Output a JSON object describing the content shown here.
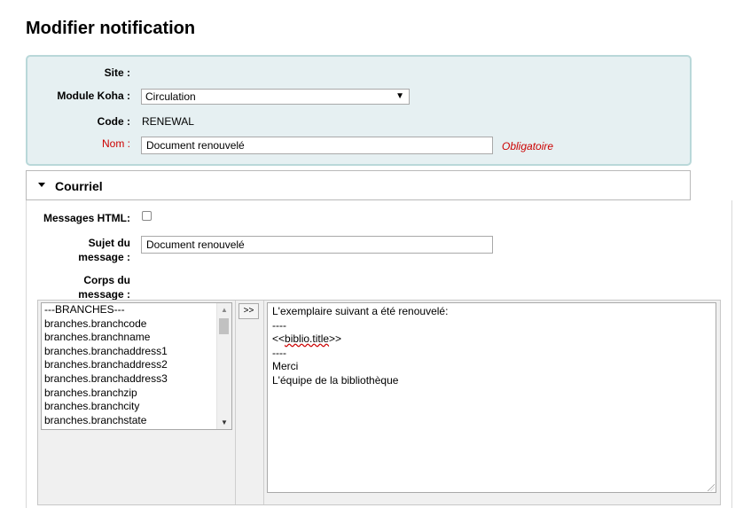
{
  "page": {
    "title": "Modifier notification"
  },
  "form": {
    "site_label": "Site :",
    "module_label": "Module Koha :",
    "module_value": "Circulation",
    "code_label": "Code :",
    "code_value": "RENEWAL",
    "name_label": "Nom :",
    "name_value": "Document renouvelé",
    "required_text": "Obligatoire"
  },
  "email_section": {
    "title": "Courriel",
    "html_label": "Messages HTML:",
    "html_checked": false,
    "subject_label_1": "Sujet du",
    "subject_label_2": "message :",
    "subject_value": "Document renouvelé",
    "body_label_1": "Corps du",
    "body_label_2": "message :",
    "insert_button": ">>",
    "fields": [
      "---BRANCHES---",
      "branches.branchcode",
      "branches.branchname",
      "branches.branchaddress1",
      "branches.branchaddress2",
      "branches.branchaddress3",
      "branches.branchzip",
      "branches.branchcity",
      "branches.branchstate"
    ],
    "body_lines": {
      "l1": "L'exemplaire suivant a été renouvelé:",
      "l2": "----",
      "l3_pre": "<<",
      "l3_word": "biblio.title",
      "l3_post": ">>",
      "l4": "----",
      "l5": "Merci",
      "l6": "L'équipe de la bibliothèque"
    }
  }
}
